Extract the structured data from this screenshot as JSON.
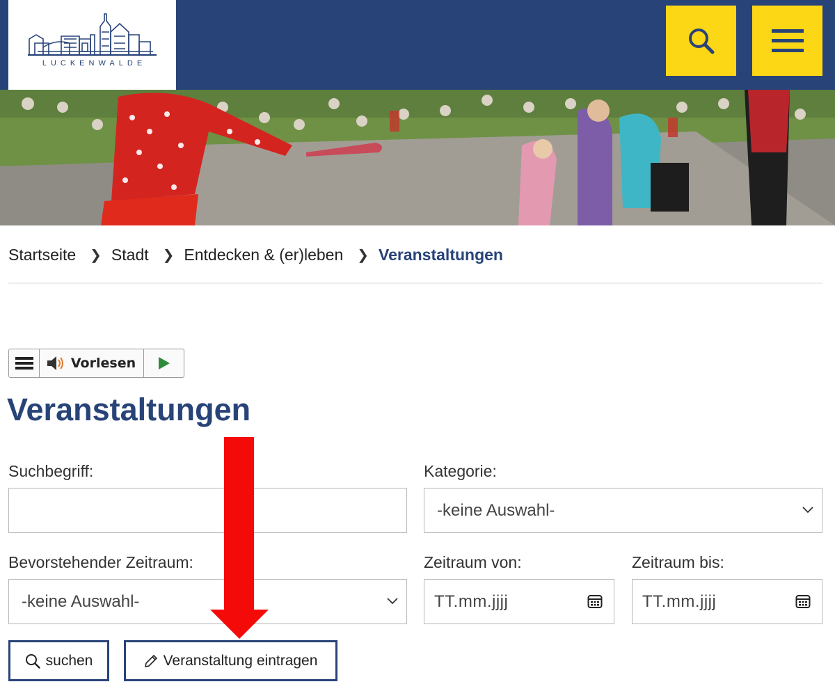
{
  "header": {
    "logo_text": "LUCKENWALDE",
    "search_icon": "search-icon",
    "menu_icon": "hamburger-icon",
    "background_color": "#284378",
    "button_color": "#fcd715"
  },
  "hero": {
    "image": "photo of children watching a clown juggling on an outdoor stage"
  },
  "breadcrumb": {
    "items": [
      "Startseite",
      "Stadt",
      "Entdecken & (er)leben"
    ],
    "current": "Veranstaltungen"
  },
  "readspeaker": {
    "label": "Vorlesen"
  },
  "page": {
    "title": "Veranstaltungen"
  },
  "form": {
    "search_label": "Suchbegriff:",
    "search_value": "",
    "category_label": "Kategorie:",
    "category_value": "-keine Auswahl-",
    "period_label": "Bevorstehender Zeitraum:",
    "period_value": "-keine Auswahl-",
    "from_label": "Zeitraum von:",
    "from_placeholder": "TT.mm.jjjj",
    "to_label": "Zeitraum bis:",
    "to_placeholder": "TT.mm.jjjj"
  },
  "buttons": {
    "search": "suchen",
    "add_event": "Veranstaltung eintragen"
  },
  "colors": {
    "accent": "#284378",
    "annotation_arrow": "#f50a0a"
  }
}
